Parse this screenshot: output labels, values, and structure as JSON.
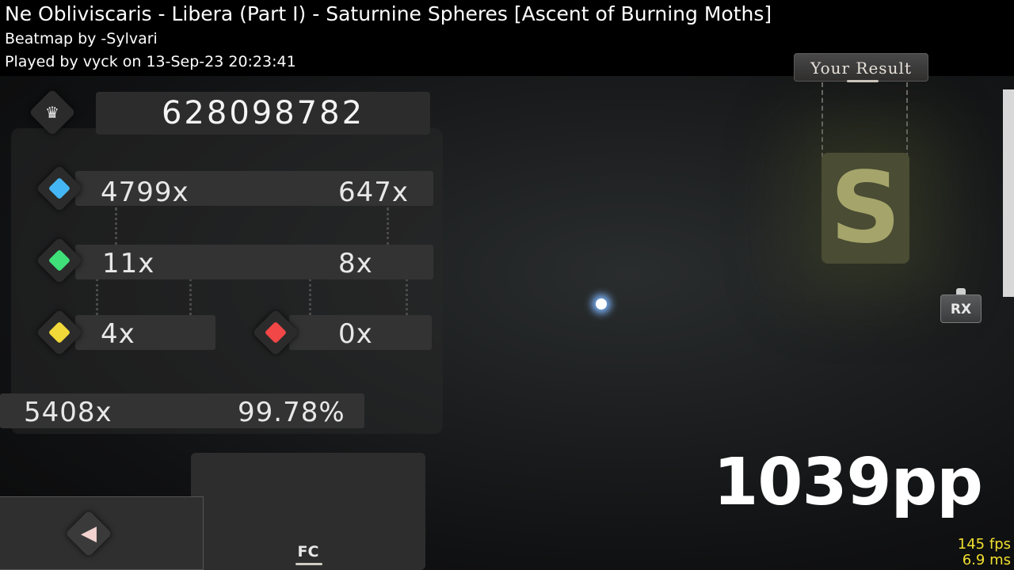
{
  "header": {
    "title": "Ne Obliviscaris - Libera (Part I) - Saturnine Spheres [Ascent of Burning Moths]",
    "beatmap": "Beatmap by -Sylvari",
    "played": "Played by vyck on 13-Sep-23 20:23:41"
  },
  "result_tab": "Your Result",
  "grade": "S",
  "mod": "RX",
  "score": "628098782",
  "hits": {
    "great": "4799x",
    "geki": "647x",
    "ok": "11x",
    "katu": "8x",
    "meh": "4x",
    "miss": "0x"
  },
  "combo": "5408x",
  "accuracy": "99.78%",
  "fc_label": "FC",
  "pp": "1039pp",
  "fps": "145 fps",
  "frametime": "6.9 ms",
  "colors": {
    "great": "#45b6f5",
    "ok": "#3fe07a",
    "meh": "#f1d93a",
    "miss": "#f24747",
    "fps": "#f0e030"
  },
  "icons": {
    "score": "crown-icon",
    "back": "back-arrow-icon"
  }
}
